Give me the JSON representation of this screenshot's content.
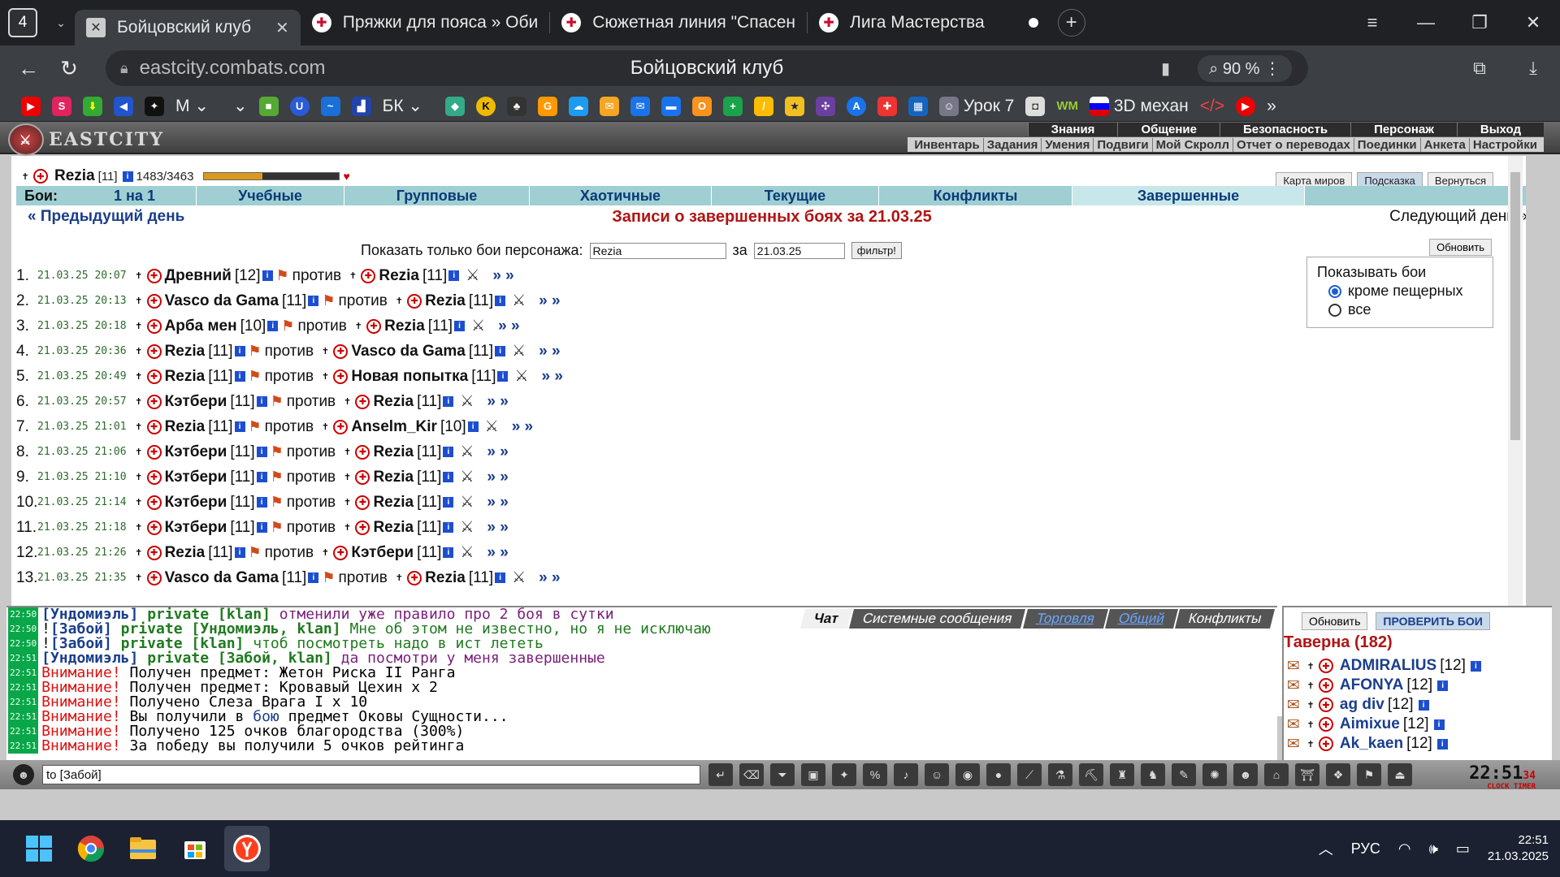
{
  "browser": {
    "tab_count": "4",
    "tabs": [
      {
        "label": "Бойцовский клуб",
        "active": true
      },
      {
        "label": "Пряжки для пояса » Оби",
        "active": false
      },
      {
        "label": "Сюжетная линия \"Спасен",
        "active": false
      },
      {
        "label": "Лига Мастерства",
        "active": false
      }
    ],
    "url": "eastcity.combats.com",
    "page_title": "Бойцовский клуб",
    "zoom": "90 %",
    "bookmarks": {
      "m_label": "М",
      "bk_label": "БК",
      "lesson_label": "Урок 7",
      "wm_label": "WM",
      "mech_label": "3D механ"
    }
  },
  "game": {
    "logo": "EASTCITY",
    "top_menu": [
      "Знания",
      "Общение",
      "Безопасность",
      "Персонаж",
      "Выход"
    ],
    "sub_menu": [
      "Инвентарь",
      "Задания",
      "Умения",
      "Подвиги",
      "Мой Скролл",
      "Отчет о переводах",
      "Поединки",
      "Анкета",
      "Настройки"
    ],
    "character": {
      "name": "Rezia",
      "level": "[11]",
      "hp": "1483/3463",
      "hp_fraction": 0.43
    },
    "top_buttons": [
      "Карта миров",
      "Подсказка",
      "Вернуться"
    ],
    "battle_types_label": "Бои:",
    "battle_types": [
      {
        "label": "1 на 1",
        "selected": false
      },
      {
        "label": "Учебные",
        "selected": false
      },
      {
        "label": "Групповые",
        "selected": false
      },
      {
        "label": "Хаотичные",
        "selected": false
      },
      {
        "label": "Текущие",
        "selected": false
      },
      {
        "label": "Конфликты",
        "selected": false
      },
      {
        "label": "Завершенные",
        "selected": true
      }
    ],
    "prev_day": "« Предыдущий день",
    "day_title": "Записи о завершенных боях за 21.03.25",
    "next_day": "Следующий день »",
    "filter": {
      "label": "Показать только бои персонажа:",
      "name_value": "Rezia",
      "for_label": "за",
      "date_value": "21.03.25",
      "button": "фильтр!"
    },
    "refresh": "Обновить",
    "show_box": {
      "title": "Показывать бои",
      "options": [
        {
          "label": "кроме пещерных",
          "checked": true
        },
        {
          "label": "все",
          "checked": false
        }
      ]
    },
    "versus": "против",
    "battles": [
      {
        "n": "1.",
        "ts": "21.03.25 20:07",
        "a": "Древний",
        "al": "[12]",
        "b": "Rezia",
        "bl": "[11]"
      },
      {
        "n": "2.",
        "ts": "21.03.25 20:13",
        "a": "Vasco da Gama",
        "al": "[11]",
        "b": "Rezia",
        "bl": "[11]"
      },
      {
        "n": "3.",
        "ts": "21.03.25 20:18",
        "a": "Арба мен",
        "al": "[10]",
        "b": "Rezia",
        "bl": "[11]"
      },
      {
        "n": "4.",
        "ts": "21.03.25 20:36",
        "a": "Rezia",
        "al": "[11]",
        "b": "Vasco da Gama",
        "bl": "[11]"
      },
      {
        "n": "5.",
        "ts": "21.03.25 20:49",
        "a": "Rezia",
        "al": "[11]",
        "b": "Новая попытка",
        "bl": "[11]"
      },
      {
        "n": "6.",
        "ts": "21.03.25 20:57",
        "a": "Кэтбери",
        "al": "[11]",
        "b": "Rezia",
        "bl": "[11]"
      },
      {
        "n": "7.",
        "ts": "21.03.25 21:01",
        "a": "Rezia",
        "al": "[11]",
        "b": "Anselm_Kir",
        "bl": "[10]"
      },
      {
        "n": "8.",
        "ts": "21.03.25 21:06",
        "a": "Кэтбери",
        "al": "[11]",
        "b": "Rezia",
        "bl": "[11]"
      },
      {
        "n": "9.",
        "ts": "21.03.25 21:10",
        "a": "Кэтбери",
        "al": "[11]",
        "b": "Rezia",
        "bl": "[11]"
      },
      {
        "n": "10.",
        "ts": "21.03.25 21:14",
        "a": "Кэтбери",
        "al": "[11]",
        "b": "Rezia",
        "bl": "[11]"
      },
      {
        "n": "11.",
        "ts": "21.03.25 21:18",
        "a": "Кэтбери",
        "al": "[11]",
        "b": "Rezia",
        "bl": "[11]"
      },
      {
        "n": "12.",
        "ts": "21.03.25 21:26",
        "a": "Rezia",
        "al": "[11]",
        "b": "Кэтбери",
        "bl": "[11]"
      },
      {
        "n": "13.",
        "ts": "21.03.25 21:35",
        "a": "Vasco da Gama",
        "al": "[11]",
        "b": "Rezia",
        "bl": "[11]"
      }
    ],
    "arrow": "» »"
  },
  "chat": {
    "tabs": [
      "Чат",
      "Системные сообщения",
      "Торговля",
      "Общий",
      "Конфликты"
    ],
    "lines": [
      {
        "t": "22:50",
        "pre": "",
        "who": "[Ундомиэль]",
        "priv": "private [klan]",
        "msg": "отменили уже правило про 2 боя в сутки",
        "cls": "msg-p"
      },
      {
        "t": "22:50",
        "pre": "! ",
        "who": "[Забой]",
        "priv": "private [Ундомиэль, klan]",
        "msg": "Мне об этом не известно, но я не исключаю",
        "cls": "msg-g"
      },
      {
        "t": "22:50",
        "pre": "! ",
        "who": "[Забой]",
        "priv": "private [klan]",
        "msg": "чтоб посмотреть надо в ист лететь",
        "cls": "msg-g"
      },
      {
        "t": "22:51",
        "pre": "",
        "who": "[Ундомиэль]",
        "priv": "private [Забой, klan]",
        "msg": "да посмотри у меня завершенные",
        "cls": "msg-p"
      }
    ],
    "warning": "Внимание!",
    "system": [
      "Получен предмет: Жетон Риска II Ранга",
      "Получен предмет: Кровавый Цехин x 2",
      "Получено Слеза Врага I x 10",
      "Вы получили в",
      "Получено 125 очков благородства (300%)",
      "За победу вы получили 5 очков рейтинга"
    ],
    "sys_battle_link": "бою",
    "sys_battle_tail": "предмет Оковы Сущности...",
    "sys_time": "22:51",
    "input_value": "to [Забой]"
  },
  "roster": {
    "refresh": "Обновить",
    "check": "ПРОВЕРИТЬ БОИ",
    "title": "Таверна (182)",
    "users": [
      {
        "name": "ADMIRALIUS",
        "lvl": "[12]"
      },
      {
        "name": "AFONYA",
        "lvl": "[12]"
      },
      {
        "name": "ag div",
        "lvl": "[12]"
      },
      {
        "name": "Aimixue",
        "lvl": "[12]"
      },
      {
        "name": "Ak_kaen",
        "lvl": "[12]"
      }
    ]
  },
  "clock": {
    "time": "22:51",
    "sec": "34",
    "clock_label": "CLOCK",
    "timer_label": "TIMER"
  },
  "taskbar": {
    "lang": "РУС",
    "time": "22:51",
    "date": "21.03.2025"
  },
  "colors": {
    "accent_red": "#b01414",
    "link_blue": "#1a3e8c",
    "tab_teal": "#9fcfd2"
  }
}
